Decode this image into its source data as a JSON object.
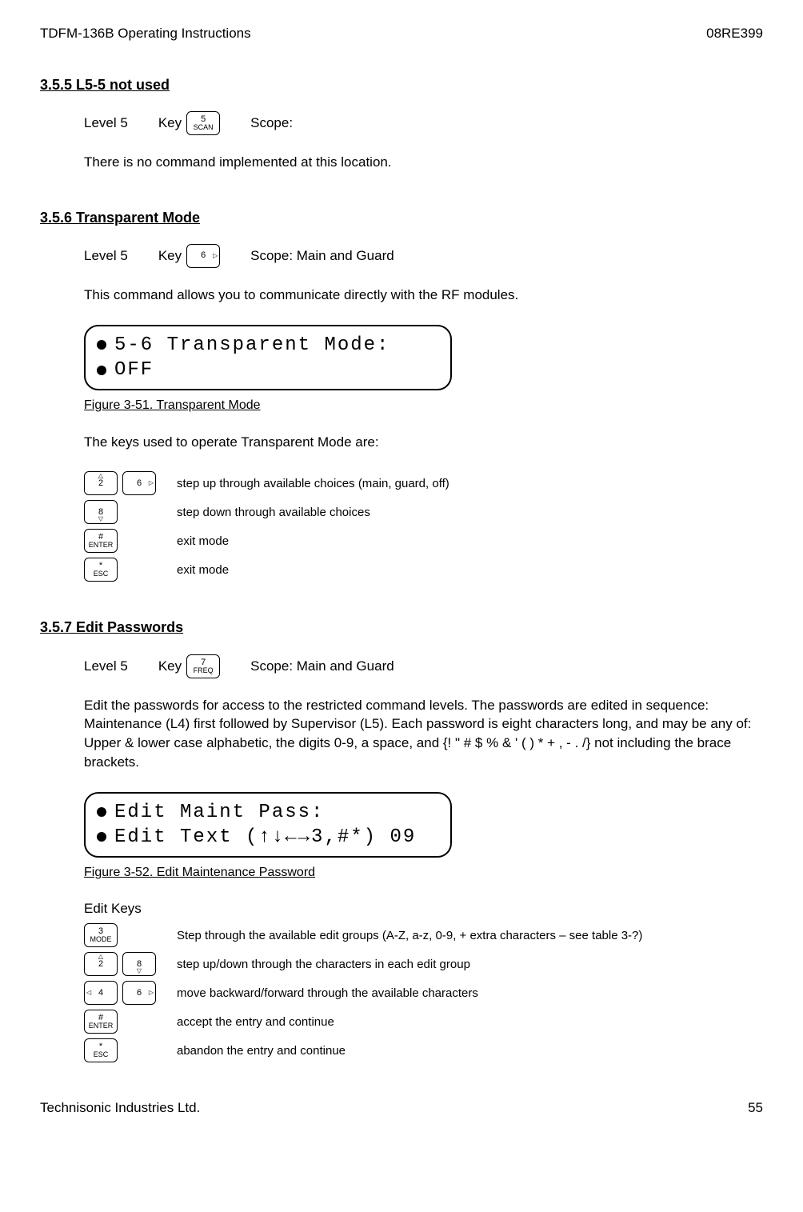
{
  "header": {
    "left": "TDFM-136B Operating Instructions",
    "right": "08RE399"
  },
  "footer": {
    "left": "Technisonic Industries Ltd.",
    "right": "55"
  },
  "s355": {
    "heading": "3.5.5   L5-5 not used",
    "level": "Level 5",
    "keylabel": "Key",
    "key": {
      "top": "5",
      "bot": "SCAN"
    },
    "scope": "Scope:",
    "para": "There is no command implemented at this location."
  },
  "s356": {
    "heading": "3.5.6   Transparent Mode",
    "level": "Level 5",
    "keylabel": "Key",
    "key": {
      "top": "6"
    },
    "scope": "Scope: Main and Guard",
    "para": "This command allows you to communicate directly with the RF modules.",
    "lcd": {
      "l1": "5-6 Transparent Mode:",
      "l2": "OFF"
    },
    "caption": "Figure 3-51. Transparent Mode",
    "keystext": "The keys used to operate Transparent Mode are:",
    "rows": [
      {
        "keys": [
          {
            "top": "2"
          },
          {
            "top": "6"
          }
        ],
        "desc": "step up through available choices (main, guard, off)"
      },
      {
        "keys": [
          {
            "top": "8"
          }
        ],
        "desc": "step down through available choices"
      },
      {
        "keys": [
          {
            "top": "#",
            "bot": "ENTER"
          }
        ],
        "desc": "exit mode"
      },
      {
        "keys": [
          {
            "top": "*",
            "bot": "ESC"
          }
        ],
        "desc": "exit  mode"
      }
    ]
  },
  "s357": {
    "heading": "3.5.7   Edit Passwords",
    "level": "Level 5",
    "keylabel": "Key",
    "key": {
      "top": "7",
      "bot": "FREQ"
    },
    "scope": "Scope: Main and Guard",
    "para": "Edit the passwords for access to the restricted command levels.  The passwords are edited in sequence: Maintenance (L4) first followed by Supervisor (L5).  Each password is eight characters long, and may be any of: Upper & lower case alphabetic, the digits 0-9, a space, and {! \" # $ % & ' ( ) * + , - . /}  not including the brace brackets.",
    "lcd": {
      "l1": "Edit Maint Pass:",
      "l2": "Edit Text (↑↓←→3,#*)  09"
    },
    "caption": "Figure 3-52. Edit Maintenance Password",
    "editkeys": "Edit Keys",
    "rows": [
      {
        "keys": [
          {
            "top": "3",
            "bot": "MODE"
          }
        ],
        "desc": "Step through the available edit groups (A-Z, a-z, 0-9, + extra characters – see table 3-?)"
      },
      {
        "keys": [
          {
            "top": "2"
          },
          {
            "top": "8"
          }
        ],
        "desc": "step up/down through the characters in each edit group"
      },
      {
        "keys": [
          {
            "top": "4"
          },
          {
            "top": "6"
          }
        ],
        "desc": "move backward/forward through the available characters"
      },
      {
        "keys": [
          {
            "top": "#",
            "bot": "ENTER"
          }
        ],
        "desc": "accept the entry and continue"
      },
      {
        "keys": [
          {
            "top": "*",
            "bot": "ESC"
          }
        ],
        "desc": "abandon the entry and continue"
      }
    ]
  }
}
